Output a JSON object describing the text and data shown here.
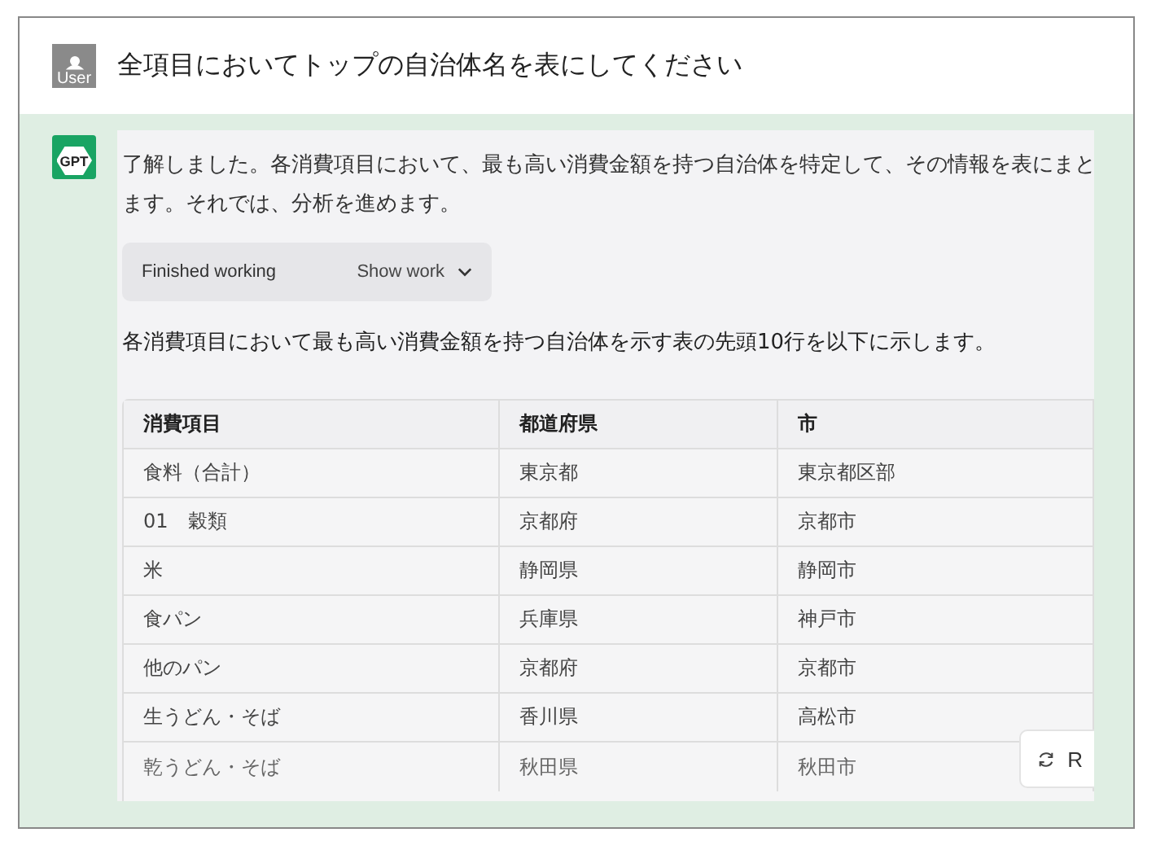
{
  "user_message": {
    "avatar_label": "User",
    "text": "全項目においてトップの自治体名を表にしてください"
  },
  "assistant_message": {
    "avatar_label": "GPT",
    "intro_lines": [
      "了解しました。各消費項目において、最も高い消費金額を持つ自治体を特定して、その情報を表にまと",
      "ます。それでは、分析を進めます。"
    ],
    "work_panel": {
      "status": "Finished working",
      "toggle": "Show work",
      "expanded": false
    },
    "summary": "各消費項目において最も高い消費金額を持つ自治体を示す表の先頭10行を以下に示します。",
    "table": {
      "columns": [
        "消費項目",
        "都道府県",
        "市"
      ],
      "rows": [
        [
          "食料（合計）",
          "東京都",
          "東京都区部"
        ],
        [
          "01　穀類",
          "京都府",
          "京都市"
        ],
        [
          "米",
          "静岡県",
          "静岡市"
        ],
        [
          "食パン",
          "兵庫県",
          "神戸市"
        ],
        [
          "他のパン",
          "京都府",
          "京都市"
        ],
        [
          "生うどん・そば",
          "香川県",
          "高松市"
        ],
        [
          "乾うどん・そば",
          "秋田県",
          "秋田市"
        ]
      ]
    },
    "regenerate_button": {
      "label": "R"
    }
  }
}
